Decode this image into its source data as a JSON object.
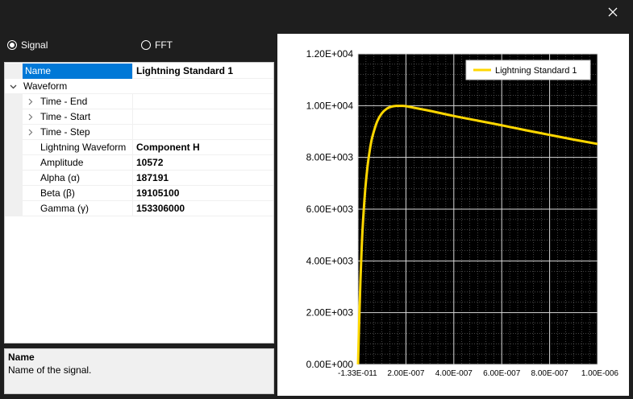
{
  "window": {
    "close_icon": "close-icon"
  },
  "mode": {
    "options": [
      {
        "label": "Signal",
        "checked": true
      },
      {
        "label": "FFT",
        "checked": false
      }
    ]
  },
  "properties": {
    "rows": [
      {
        "label": "Name",
        "value": "Lightning Standard 1"
      },
      {
        "label": "Waveform",
        "value": ""
      },
      {
        "label": "Time - End",
        "value": ""
      },
      {
        "label": "Time - Start",
        "value": ""
      },
      {
        "label": "Time - Step",
        "value": ""
      },
      {
        "label": "Lightning Waveform",
        "value": "Component H"
      },
      {
        "label": "Amplitude",
        "value": "10572"
      },
      {
        "label": "Alpha (α)",
        "value": "187191"
      },
      {
        "label": "Beta (β)",
        "value": "19105100"
      },
      {
        "label": "Gamma (γ)",
        "value": "153306000"
      }
    ]
  },
  "description": {
    "title": "Name",
    "text": "Name of the signal."
  },
  "chart_data": {
    "type": "line",
    "x_tick_labels": [
      "-1.33E-011",
      "2.00E-007",
      "4.00E-007",
      "6.00E-007",
      "8.00E-007",
      "1.00E-006"
    ],
    "y_tick_labels": [
      "0.00E+000",
      "2.00E+003",
      "4.00E+003",
      "6.00E+003",
      "8.00E+003",
      "1.00E+004",
      "1.20E+004"
    ],
    "xlim": [
      -1.33e-11,
      1e-06
    ],
    "ylim": [
      0,
      12000
    ],
    "x_ticks": [
      -1.33e-11,
      2e-07,
      4e-07,
      6e-07,
      8e-07,
      1e-06
    ],
    "y_ticks": [
      0,
      2000,
      4000,
      6000,
      8000,
      10000,
      12000
    ],
    "grid": true,
    "legend_position": "top-right",
    "series": [
      {
        "name": "Lightning Standard 1",
        "color": "#ffd700",
        "x": [
          0,
          5e-09,
          1e-08,
          1.5e-08,
          2e-08,
          3e-08,
          4e-08,
          5e-08,
          6e-08,
          8e-08,
          1e-07,
          1.2e-07,
          1.4e-07,
          1.6e-07,
          1.8e-07,
          2e-07,
          2.5e-07,
          3e-07,
          4e-07,
          5e-07,
          6e-07,
          7e-07,
          8e-07,
          9e-07,
          1e-06
        ],
        "y": [
          0,
          1720,
          3230,
          4450,
          5390,
          6750,
          7680,
          8330,
          8800,
          9390,
          9710,
          9880,
          9960,
          9990,
          9990,
          9980,
          9890,
          9800,
          9600,
          9420,
          9240,
          9050,
          8870,
          8690,
          8520
        ]
      }
    ]
  }
}
